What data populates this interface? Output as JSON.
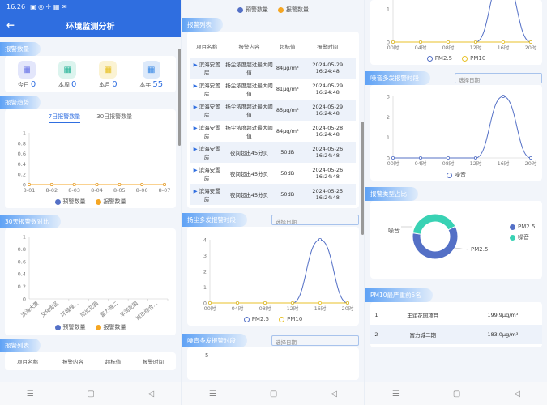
{
  "status": {
    "time": "16:26",
    "icons": "▣ ◎ ✈ ▦ ✉"
  },
  "header": {
    "title": "环境监测分析",
    "back": "←"
  },
  "alarm_count": {
    "section": "报警数量",
    "items": [
      {
        "label": "今日",
        "value": "0",
        "color": "#6f7ae8",
        "bg": "#e3e6fb",
        "icon": "calendar-icon"
      },
      {
        "label": "本周",
        "value": "0",
        "color": "#2bb59a",
        "bg": "#dcf4ee",
        "icon": "week-icon"
      },
      {
        "label": "本月",
        "value": "0",
        "color": "#e8c22a",
        "bg": "#fbf3d3",
        "icon": "month-icon"
      },
      {
        "label": "本年",
        "value": "55",
        "color": "#3c8be6",
        "bg": "#dce9fa",
        "icon": "year-icon"
      }
    ]
  },
  "trend": {
    "section": "报警趋势",
    "tabs": [
      "7日报警数量",
      "30日报警数量"
    ],
    "legend": [
      "预警数量",
      "报警数量"
    ]
  },
  "comparison": {
    "section": "30天报警数对比",
    "legend": [
      "预警数量",
      "报警数量"
    ]
  },
  "alarm_list": {
    "section": "报警列表",
    "headers": [
      "项目名称",
      "报警内容",
      "超标值",
      "报警时间"
    ],
    "rows": [
      {
        "name": "滨海安置房",
        "content": "扬尘浓度超过最大阈值",
        "value": "84μg/m³",
        "time": "2024-05-29 16:24:48"
      },
      {
        "name": "滨海安置房",
        "content": "扬尘浓度超过最大阈值",
        "value": "81μg/m³",
        "time": "2024-05-29 16:24:48"
      },
      {
        "name": "滨海安置房",
        "content": "扬尘浓度超过最大阈值",
        "value": "85μg/m³",
        "time": "2024-05-29 16:24:48"
      },
      {
        "name": "滨海安置房",
        "content": "扬尘浓度超过最大阈值",
        "value": "84μg/m³",
        "time": "2024-05-28 16:24:48"
      },
      {
        "name": "滨海安置房",
        "content": "夜间超出45分贝",
        "value": "50dB",
        "time": "2024-05-26 16:24:48"
      },
      {
        "name": "滨海安置房",
        "content": "夜间超出45分贝",
        "value": "50dB",
        "time": "2024-05-26 16:24:48"
      },
      {
        "name": "滨海安置房",
        "content": "夜间超出45分贝",
        "value": "50dB",
        "time": "2024-05-25 16:24:48"
      }
    ]
  },
  "dust_period": {
    "section": "扬尘多发报警时段",
    "placeholder": "选择日期",
    "legend": [
      "PM2.5",
      "PM10"
    ]
  },
  "noise_period": {
    "section": "噪音多发报警时段",
    "placeholder": "选择日期",
    "legend": [
      "噪音"
    ]
  },
  "type_ratio": {
    "section": "报警类型占比",
    "legend": [
      "PM2.5",
      "噪音"
    ],
    "label_left": "噪音",
    "label_right": "PM2.5"
  },
  "pm10_rank": {
    "section": "PM10最严重前5名",
    "rows": [
      {
        "rank": "1",
        "name": "丰润花园项目",
        "value": "199.9μg/m³"
      },
      {
        "rank": "2",
        "name": "富力城二期",
        "value": "183.0μg/m³"
      }
    ]
  },
  "nav": {
    "menu": "☰",
    "home": "▢",
    "back": "◁"
  },
  "chart_data": [
    {
      "type": "line",
      "title": "报警趋势",
      "categories": [
        "8-01",
        "8-02",
        "8-03",
        "8-04",
        "8-05",
        "8-06",
        "8-07"
      ],
      "series": [
        {
          "name": "预警数量",
          "values": [
            0,
            0,
            0,
            0,
            0,
            0,
            0
          ],
          "color": "#5470c6"
        },
        {
          "name": "报警数量",
          "values": [
            0,
            0,
            0,
            0,
            0,
            0,
            0
          ],
          "color": "#f5a623"
        }
      ],
      "yticks": [
        "0",
        "0.2",
        "0.4",
        "0.6",
        "0.8",
        "1"
      ],
      "ylim": [
        0,
        1
      ]
    },
    {
      "type": "bar",
      "title": "30天报警数对比",
      "categories": [
        "滨海大厦",
        "文化街区",
        "环城绿...",
        "阳光花园",
        "富力城二",
        "丰润花园",
        "城市综合..."
      ],
      "series": [
        {
          "name": "预警数量",
          "values": [
            0,
            0,
            0,
            0,
            0,
            0,
            0
          ],
          "color": "#5470c6"
        },
        {
          "name": "报警数量",
          "values": [
            0,
            0,
            0,
            0,
            0,
            0,
            0
          ],
          "color": "#f5a623"
        }
      ],
      "yticks": [
        "0",
        "0.2",
        "0.4",
        "0.6",
        "0.8",
        "1"
      ],
      "ylim": [
        0,
        1
      ]
    },
    {
      "type": "line",
      "title": "扬尘多发报警时段",
      "categories": [
        "00时",
        "04时",
        "08时",
        "12时",
        "16时",
        "20时"
      ],
      "series": [
        {
          "name": "PM2.5",
          "values": [
            0,
            0,
            0,
            0,
            4,
            0
          ],
          "color": "#5470c6"
        },
        {
          "name": "PM10",
          "values": [
            0,
            0,
            0,
            0,
            0,
            0
          ],
          "color": "#e8c22a"
        }
      ],
      "yticks": [
        "0",
        "1",
        "2",
        "3",
        "4"
      ],
      "ylim": [
        0,
        4
      ]
    },
    {
      "type": "line",
      "title": "噪音多发报警时段",
      "categories": [
        "00时",
        "04时",
        "08时",
        "12时",
        "16时",
        "20时"
      ],
      "series": [
        {
          "name": "噪音",
          "values": [
            0,
            0,
            0,
            0,
            3,
            0
          ],
          "color": "#5470c6"
        }
      ],
      "yticks": [
        "0",
        "1",
        "2",
        "3"
      ],
      "ylim": [
        0,
        3
      ]
    },
    {
      "type": "pie",
      "title": "报警类型占比",
      "categories": [
        "PM2.5",
        "噪音"
      ],
      "values": [
        60,
        40
      ],
      "colors": [
        "#5470c6",
        "#39d2b4"
      ]
    }
  ]
}
